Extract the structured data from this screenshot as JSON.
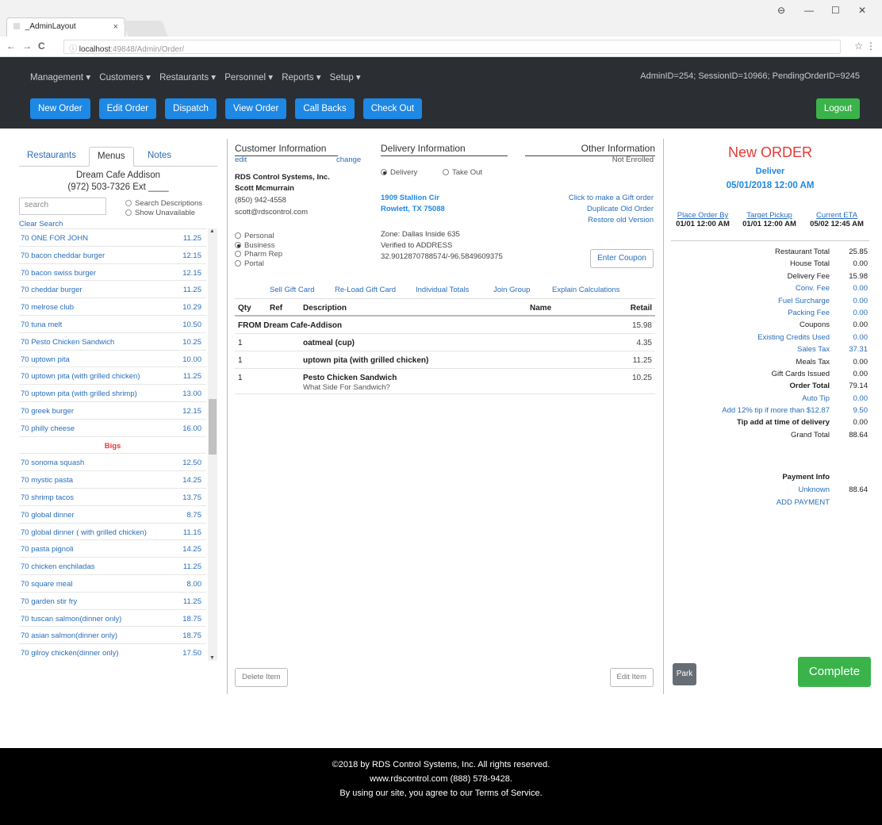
{
  "browser": {
    "tab_title": "_AdminLayout",
    "tab_close": "×",
    "url_host": "localhost",
    "url_rest": ":49848/Admin/Order/",
    "url_prefix": "ⓘ",
    "win_user": "⊖",
    "win_min": "—",
    "win_max": "☐",
    "win_close": "✕",
    "back": "←",
    "forward": "→",
    "reload": "C",
    "star": "☆",
    "menu": "⋮"
  },
  "nav": {
    "menus": [
      "Management ▾",
      "Customers ▾",
      "Restaurants ▾",
      "Personnel ▾",
      "Reports ▾",
      "Setup ▾"
    ],
    "session": "AdminID=254; SessionID=10966; PendingOrderID=9245",
    "buttons": [
      "New Order",
      "Edit Order",
      "Dispatch",
      "View Order",
      "Call Backs",
      "Check Out"
    ],
    "logout": "Logout"
  },
  "left": {
    "tabs": [
      "Restaurants",
      "Menus",
      "Notes"
    ],
    "restaurant_name": "Dream Cafe Addison",
    "restaurant_phone": "(972) 503-7326 Ext ____",
    "search_placeholder": "search",
    "search_desc": "Search Descriptions",
    "show_unavail": "Show Unavailable",
    "clear_search": "Clear Search",
    "items": [
      {
        "name": "70 ONE FOR JOHN",
        "price": "11.25"
      },
      {
        "name": "70 bacon cheddar burger",
        "price": "12.15"
      },
      {
        "name": "70 bacon swiss burger",
        "price": "12.15"
      },
      {
        "name": "70 cheddar burger",
        "price": "11.25"
      },
      {
        "name": "70 melrose club",
        "price": "10.29"
      },
      {
        "name": "70 tuna melt",
        "price": "10.50"
      },
      {
        "name": "70 Pesto Chicken Sandwich",
        "price": "10.25"
      },
      {
        "name": "70 uptown pita",
        "price": "10.00"
      },
      {
        "name": "70 uptown pita (with grilled chicken)",
        "price": "11.25"
      },
      {
        "name": "70 uptown pita (with grilled shrimp)",
        "price": "13.00"
      },
      {
        "name": "70 greek burger",
        "price": "12.15"
      },
      {
        "name": "70 philly cheese",
        "price": "16.00"
      },
      {
        "name": "Bigs",
        "price": "",
        "category": true
      },
      {
        "name": "70 sonoma squash",
        "price": "12.50"
      },
      {
        "name": "70 mystic pasta",
        "price": "14.25"
      },
      {
        "name": "70 shrimp tacos",
        "price": "13.75"
      },
      {
        "name": "70 global dinner",
        "price": "8.75"
      },
      {
        "name": "70 global dinner ( with grilled chicken)",
        "price": "11.15"
      },
      {
        "name": "70 pasta pignoli",
        "price": "14.25"
      },
      {
        "name": "70 chicken enchiladas",
        "price": "11.25"
      },
      {
        "name": "70 square meal",
        "price": "8.00"
      },
      {
        "name": "70 garden stir fry",
        "price": "11.25"
      },
      {
        "name": "70 tuscan salmon(dinner only)",
        "price": "18.75"
      },
      {
        "name": "70 asian salmon(dinner only)",
        "price": "18.75"
      },
      {
        "name": "70 gilroy chicken(dinner only)",
        "price": "17.50"
      }
    ]
  },
  "customer": {
    "header": "Customer Information",
    "edit": "edit",
    "change": "change",
    "company": "RDS Control Systems, Inc.",
    "name": "Scott Mcmurrain",
    "phone": "(850) 942-4558",
    "email": "scott@rdscontrol.com",
    "types": [
      "Personal",
      "Business",
      "Pharm Rep",
      "Portal"
    ],
    "selected_type": 1
  },
  "delivery": {
    "header": "Delivery Information",
    "opt_delivery": "Delivery",
    "opt_takeout": "Take Out",
    "address1": "1909 Stallion Cir",
    "address2": "Rowlett, TX 75088",
    "zone": "Zone: Dallas Inside 635",
    "verified": "Verified to ADDRESS",
    "coords": "32.9012870788574/-96.5849609375"
  },
  "other": {
    "header": "Other Information",
    "enrolled": "Not Enrolled",
    "gift": "Click to make a Gift order",
    "duplicate": "Duplicate Old Order",
    "restore": "Restore old Version",
    "coupon": "Enter Coupon"
  },
  "actions": [
    "Sell Gift Card",
    "Re-Load Gift Card",
    "Individual Totals",
    "Join Group",
    "Explain Calculations"
  ],
  "order_table": {
    "headers": {
      "qty": "Qty",
      "ref": "Ref",
      "desc": "Description",
      "name": "Name",
      "retail": "Retail"
    },
    "from_label": "FROM Dream Cafe-Addison",
    "from_amount": "15.98",
    "rows": [
      {
        "qty": "1",
        "desc": "oatmeal (cup)",
        "sub": "",
        "retail": "4.35"
      },
      {
        "qty": "1",
        "desc": "uptown pita (with grilled chicken)",
        "sub": "",
        "retail": "11.25"
      },
      {
        "qty": "1",
        "desc": "Pesto Chicken Sandwich",
        "sub": "What Side For Sandwich?",
        "retail": "10.25"
      }
    ],
    "delete_btn": "Delete Item",
    "edit_btn": "Edit Item"
  },
  "summary": {
    "title": "New ORDER",
    "mode": "Deliver",
    "datetime": "05/01/2018 12:00 AM",
    "cols": [
      {
        "head": "Place Order By",
        "val": "01/01 12:00 AM"
      },
      {
        "head": "Target Pickup",
        "val": "01/01 12:00 AM"
      },
      {
        "head": "Current ETA",
        "val": "05/02 12:45 AM"
      }
    ],
    "totals": [
      {
        "label": "Restaurant Total",
        "value": "25.85",
        "style": ""
      },
      {
        "label": "House Total",
        "value": "0.00",
        "style": ""
      },
      {
        "label": "Delivery Fee",
        "value": "15.98",
        "style": ""
      },
      {
        "label": "Conv. Fee",
        "value": "0.00",
        "style": "link"
      },
      {
        "label": "Fuel Surcharge",
        "value": "0.00",
        "style": "link"
      },
      {
        "label": "Packing Fee",
        "value": "0.00",
        "style": "link"
      },
      {
        "label": "Coupons",
        "value": "0.00",
        "style": ""
      },
      {
        "label": "Existing Credits Used",
        "value": "0.00",
        "style": "link"
      },
      {
        "label": "Sales Tax",
        "value": "37.31",
        "style": "link"
      },
      {
        "label": "Meals Tax",
        "value": "0.00",
        "style": ""
      },
      {
        "label": "Gift Cards Issued",
        "value": "0.00",
        "style": ""
      },
      {
        "label": "Order Total",
        "value": "79.14",
        "style": "bold"
      },
      {
        "label": "Auto Tip",
        "value": "0.00",
        "style": "link"
      },
      {
        "label": "Add 12% tip if more than $12.87",
        "value": "9.50",
        "style": "link"
      },
      {
        "label": "Tip add at time of delivery",
        "value": "0.00",
        "style": "bold"
      },
      {
        "label": "Grand Total",
        "value": "88.64",
        "style": ""
      }
    ],
    "payment_header": "Payment Info",
    "payment_method": "Unknown",
    "payment_amount": "88.64",
    "add_payment": "ADD PAYMENT",
    "park": "Park",
    "complete": "Complete"
  },
  "footer": {
    "line1": "©2018 by RDS Control Systems, Inc. All rights reserved.",
    "line2": "www.rdscontrol.com  (888) 578-9428.",
    "line3": "By using our site, you agree to our Terms of Service."
  }
}
